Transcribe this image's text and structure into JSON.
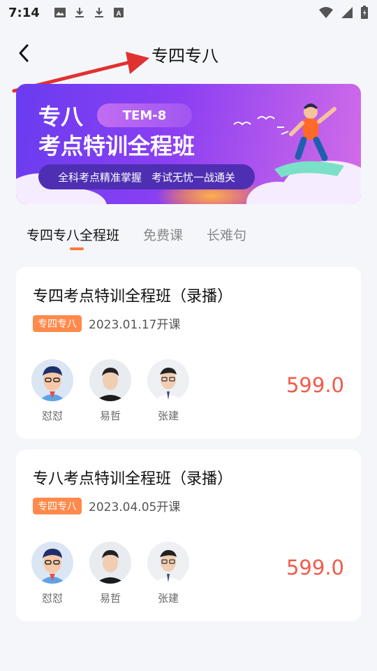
{
  "status_bar": {
    "time": "7:14",
    "left_icons": [
      "image-icon",
      "download-icon",
      "download-icon",
      "font-icon"
    ],
    "right_icons": [
      "wifi-icon",
      "signal-icon",
      "battery-icon"
    ]
  },
  "header": {
    "title": "专四专八",
    "back_icon": "chevron-left-icon"
  },
  "banner": {
    "line1": "专八",
    "tag": "TEM-8",
    "line2": "考点特训全程班",
    "slogan_left": "全科考点精准掌握",
    "slogan_right": "考试无忧一战通关"
  },
  "tabs": [
    {
      "label": "专四专八全程班",
      "active": true
    },
    {
      "label": "免费课",
      "active": false
    },
    {
      "label": "长难句",
      "active": false
    }
  ],
  "courses": [
    {
      "title": "专四考点特训全程班（录播）",
      "badge": "专四专八",
      "date": "2023.01.17开课",
      "teachers": [
        {
          "name": "怼怼"
        },
        {
          "name": "易哲"
        },
        {
          "name": "张建"
        }
      ],
      "price": "599.0"
    },
    {
      "title": "专八考点特训全程班（录播）",
      "badge": "专四专八",
      "date": "2023.04.05开课",
      "teachers": [
        {
          "name": "怼怼"
        },
        {
          "name": "易哲"
        },
        {
          "name": "张建"
        }
      ],
      "price": "599.0"
    }
  ],
  "colors": {
    "accent": "#ff7a3a",
    "price": "#f25a4a",
    "annotation_arrow": "#e03131"
  }
}
